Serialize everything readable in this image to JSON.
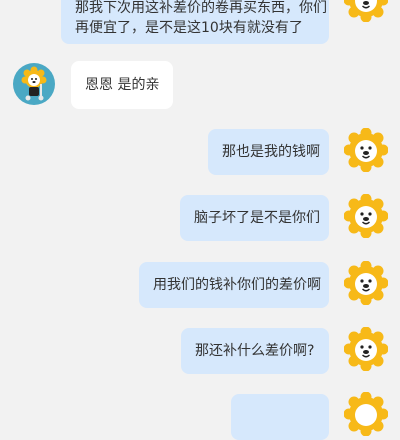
{
  "messages": [
    {
      "from": "me",
      "text": [
        "那我下次用这补差价的卷再买东西，你们",
        "再便宜了，是不是这10块有就没有了"
      ]
    },
    {
      "from": "agent",
      "text": [
        "恩恩  是的亲"
      ]
    },
    {
      "from": "me",
      "text": [
        "那也是我的钱啊"
      ]
    },
    {
      "from": "me",
      "text": [
        "脑子坏了是不是你们"
      ]
    },
    {
      "from": "me",
      "text": [
        "用我们的钱补你们的差价啊"
      ]
    },
    {
      "from": "me",
      "text": [
        "那还补什么差价啊?"
      ]
    },
    {
      "from": "me",
      "text": [
        ""
      ]
    }
  ],
  "avatars": {
    "me": "lion-mascot-icon",
    "agent": "lion-mascot-with-scooter-icon"
  },
  "colors": {
    "background": "#f2f2f2",
    "outgoing_bubble": "#d6e8fc",
    "incoming_bubble": "#ffffff",
    "mascot_mane": "#f7b918"
  }
}
